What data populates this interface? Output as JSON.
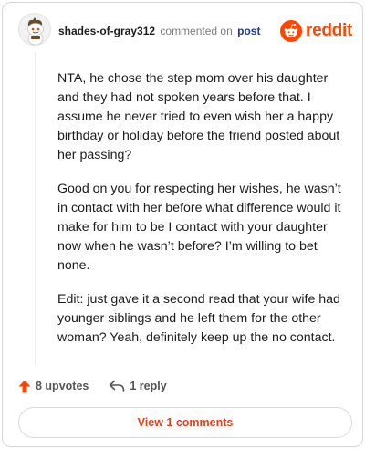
{
  "comment": {
    "author": "shades-of-gray312",
    "action_text": "commented on",
    "target_text": "post",
    "paragraphs": [
      "NTA, he chose the step mom over his daughter and they had not spoken years before that. I assume he never tried to even wish her a happy birthday or holiday before the friend posted about her passing?",
      "Good on you for respecting her wishes, he wasn’t in contact with her before what difference would it make for him to be I contact with your daughter now when he wasn’t before? I’m willing to bet none.",
      "Edit: just gave it a second read that your wife had younger siblings and he left them for the other woman? Yeah, definitely keep up the no contact."
    ]
  },
  "brand": {
    "name": "reddit",
    "icon": "reddit-logo-icon",
    "color": "#ff4500"
  },
  "actions": {
    "upvotes_label": "8 upvotes",
    "reply_label": "1 reply",
    "upvote_icon": "upvote-arrow-icon",
    "reply_icon": "reply-arrow-icon",
    "upvote_color": "#ff4500"
  },
  "view_comments_label": "View 1 comments",
  "colors": {
    "accent": "#e8401c",
    "link": "#1a3a8a",
    "muted": "#7c7c7c"
  }
}
